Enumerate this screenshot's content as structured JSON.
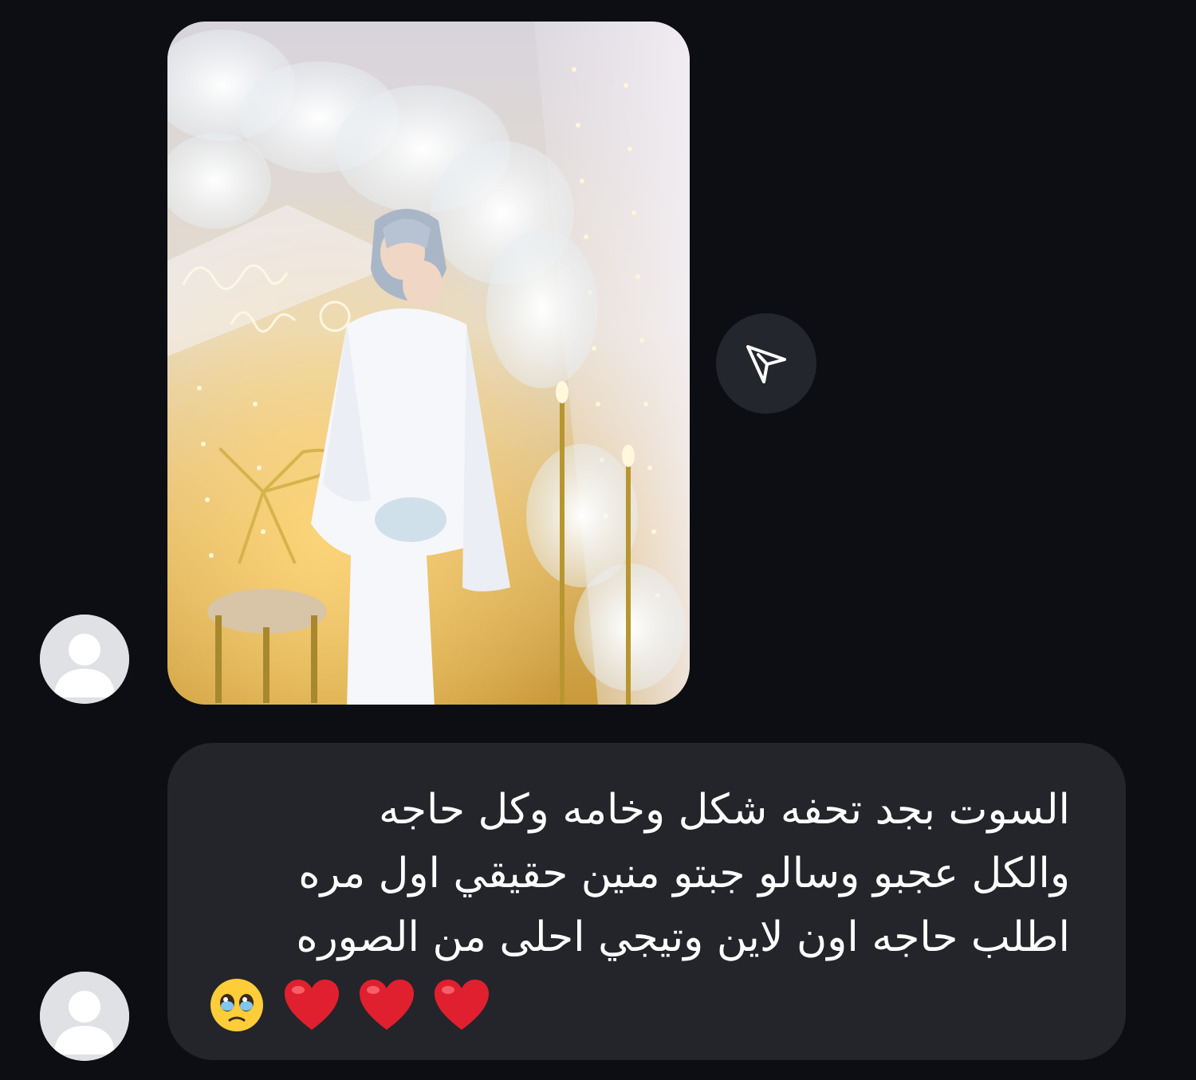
{
  "conversation": {
    "photo_message": {
      "image": "photo-of-woman-in-white-outfit-at-decorated-backdrop",
      "share_icon": "send-paper-plane-icon"
    },
    "avatar_icon": "default-user-avatar-icon",
    "text_message": {
      "lines": [
        "السوت بجد تحفه شكل وخامه وكل حاجه",
        "والكل عجبو وسالو جبتو منين حقيقي اول مره",
        "اطلب حاجه اون لاين وتيجي احلى من الصوره"
      ],
      "emojis": [
        "🥹",
        "❤️",
        "❤️",
        "❤️"
      ]
    }
  },
  "colors": {
    "background": "#0c0e13",
    "bubble": "#23252b",
    "share_button": "#23262c",
    "avatar": "#dfe1e5",
    "text": "#ffffff",
    "heart": "#e0202e"
  }
}
